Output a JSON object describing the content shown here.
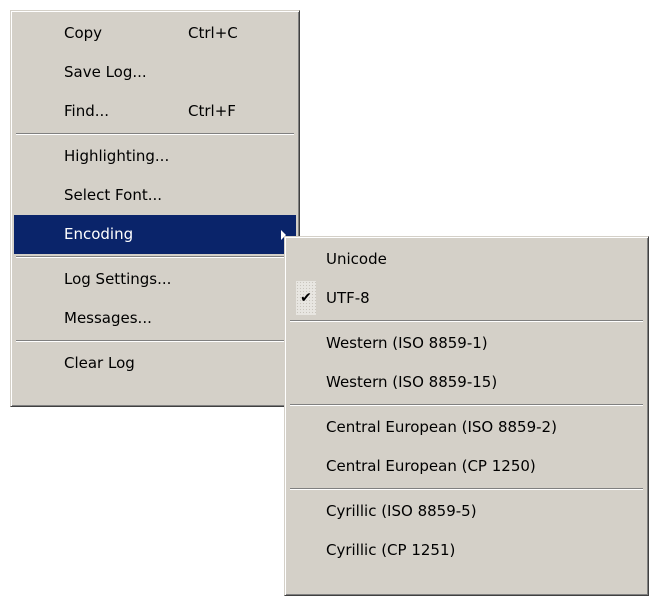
{
  "main_menu": {
    "copy": {
      "label": "Copy",
      "shortcut": "Ctrl+C"
    },
    "save_log": {
      "label": "Save Log..."
    },
    "find": {
      "label": "Find...",
      "shortcut": "Ctrl+F"
    },
    "highlighting": {
      "label": "Highlighting..."
    },
    "select_font": {
      "label": "Select Font..."
    },
    "encoding": {
      "label": "Encoding"
    },
    "log_settings": {
      "label": "Log Settings..."
    },
    "messages": {
      "label": "Messages..."
    },
    "clear_log": {
      "label": "Clear Log"
    }
  },
  "encoding_menu": {
    "unicode": {
      "label": "Unicode"
    },
    "utf8": {
      "label": "UTF-8",
      "checked": true
    },
    "western_1": {
      "label": "Western (ISO 8859-1)"
    },
    "western_15": {
      "label": "Western (ISO 8859-15)"
    },
    "central_iso": {
      "label": "Central European (ISO 8859-2)"
    },
    "central_cp": {
      "label": "Central European (CP 1250)"
    },
    "cyrillic_iso": {
      "label": "Cyrillic (ISO 8859-5)"
    },
    "cyrillic_cp": {
      "label": "Cyrillic (CP 1251)"
    }
  },
  "icons": {
    "checkmark": "check-icon",
    "submenu_arrow": "submenu-arrow-icon"
  },
  "colors": {
    "menu_bg": "#d4d0c8",
    "highlight_bg": "#0a246a",
    "highlight_text": "#ffffff"
  }
}
